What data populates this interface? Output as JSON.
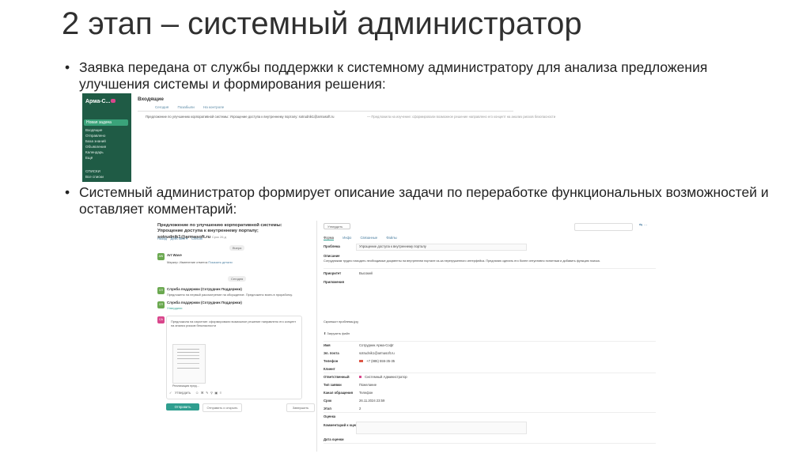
{
  "slide": {
    "title": "2 этап – системный администратор",
    "bullets": [
      "Заявка передана от службы поддержки к системному администратору для анализа предложения улучшения системы и формирования решения:",
      "Системный администратор формирует описание задачи по переработке функциональных возможностей и оставляет комментарий:"
    ],
    "bullet_char": "•"
  },
  "inbox": {
    "app_name": "Арма-С...",
    "new_task": "Новая задача",
    "header": "Входящие",
    "tabs": [
      "Сегодня",
      "Позабыли",
      "На контроле"
    ],
    "nav": [
      "Входящие",
      "Отправлено",
      "База знаний",
      "Объявления",
      "Календарь",
      "Ещё"
    ],
    "lists_label": "СПИСКИ",
    "lists_item": "Все списки",
    "row_text": "Предложение по улучшению корпоративной системы: Упрощение доступа к внутреннему порталу: sotrudnik1@armasoft.ru",
    "row_snippet": "— Предложила на изучение: сформировали возможное решение направлено его концепт на анализ рисков безопасности"
  },
  "task": {
    "title": "Предложение по улучшению корпоративной системы: Упрощение доступа к внутреннему порталу; sotrudnik1@armasoft.ru",
    "date_short": "Срок 26.д",
    "actions": [
      "Назад",
      "Действия ▾",
      "Список"
    ],
    "chips": [
      "Вчера",
      "Сегодня"
    ],
    "messages": [
      {
        "avatar": "AW",
        "name": "Art Wave",
        "text": "Маркер: Изменение отметок",
        "link": "Показать детали"
      },
      {
        "avatar": "СП",
        "name": "Служба поддержки (Сотрудник Поддержки)",
        "text": "Предложено на первый рассмотрение на обсуждение. Предложено взять в проработку."
      },
      {
        "avatar": "СП",
        "name": "Служба поддержки (Сотрудник Поддержки)",
        "text": "Утвердили"
      },
      {
        "avatar": "СА",
        "name": "",
        "text": "Предложила на изучение: сформировали возможное решение направлено его концепт на анализ рисков безопасности"
      }
    ],
    "attachment_label": "Реализация пред...",
    "approve_label": "Утвердить",
    "send_label": "Отправить",
    "open_label": "Отправить и открыть",
    "close_label": "Завершить"
  },
  "form": {
    "approve": "Утвердить",
    "tabs": [
      "Форма",
      "Инфо",
      "Связанные",
      "Файлы"
    ],
    "fields": {
      "problem_label": "Проблема",
      "problem_value": "Упрощение доступа к внутреннему порталу",
      "description_label": "Описание",
      "description_value": "Сотрудникам трудно находить необходимые документы на внутреннем портале из-за перегруженного интерфейса. Предлагаю сделать его более интуитивно понятным и добавить функцию поиска.",
      "priority_label": "Приоритет",
      "priority_value": "Высокий",
      "attachments_label": "Приложения",
      "screenshot_label": "Скриншот проблемы.jpg",
      "upload_label": "Загрузить файл",
      "name_label": "Имя",
      "name_value": "Сотрудник Арма-Софт",
      "email_label": "Эл. почта",
      "email_value": "sotrudnik1@armasoft.ru",
      "phone_label": "Телефон",
      "phone_value": "+7 (885) 555-35-35",
      "client_label": "Клиент",
      "responsible_label": "Ответственный",
      "responsible_value": "Системный Администратор",
      "type_label": "Тип заявки",
      "type_value": "Пожелание",
      "channel_label": "Канал обращения",
      "channel_value": "Телефон",
      "deadline_label": "Срок",
      "deadline_value": "26.11.2024 23:59",
      "stage_label": "Этап",
      "stage_value": "2",
      "rating_label": "Оценка",
      "comment_label": "Комментарий к оценке",
      "rating_date_label": "Дата оценки"
    }
  },
  "colors": {
    "sidebar": "#1f5b45",
    "accent": "#2f9e8f",
    "link": "#4a7ea0"
  }
}
